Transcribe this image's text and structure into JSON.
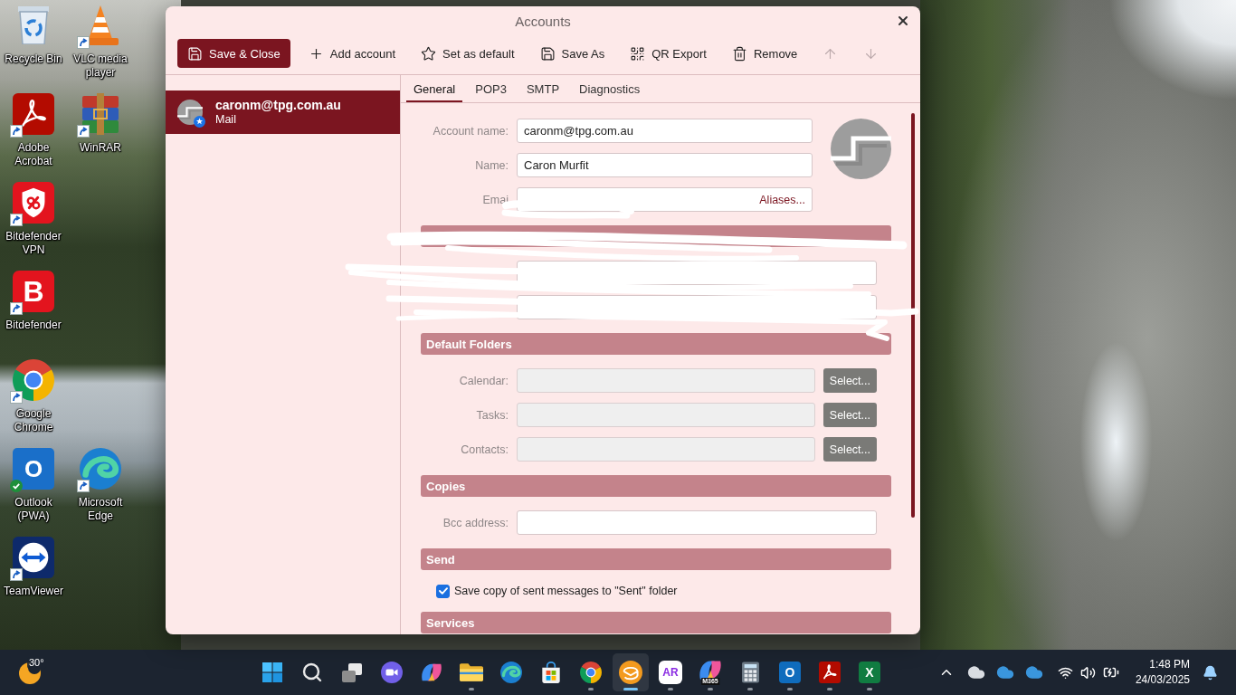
{
  "desktop_icons": [
    {
      "label": "Recycle Bin",
      "kind": "bin",
      "shortcut": false,
      "synced": false
    },
    {
      "label": "VLC media player",
      "kind": "cone",
      "shortcut": true,
      "synced": false
    },
    {
      "label": "Adobe Acrobat",
      "kind": "pdf",
      "shortcut": true,
      "synced": false
    },
    {
      "label": "WinRAR",
      "kind": "books",
      "shortcut": true,
      "synced": false
    },
    {
      "label": "Bitdefender VPN",
      "kind": "shield",
      "shortcut": true,
      "synced": false
    },
    {
      "label": "Bitdefender",
      "kind": "letter",
      "glyph": "B",
      "shortcut": true,
      "synced": false
    },
    {
      "label": "Google Chrome",
      "kind": "ring",
      "shortcut": true,
      "synced": false
    },
    {
      "label": "Outlook (PWA)",
      "kind": "mail",
      "glyph": "O",
      "shortcut": false,
      "synced": true
    },
    {
      "label": "Microsoft Edge",
      "kind": "wave",
      "shortcut": true,
      "synced": false
    },
    {
      "label": "TeamViewer",
      "kind": "arrows",
      "shortcut": true,
      "synced": false
    }
  ],
  "window": {
    "title": "Accounts"
  },
  "toolbar": [
    {
      "label": "Save & Close",
      "kind": "save",
      "primary": true,
      "disabled": false
    },
    {
      "label": "Add account",
      "kind": "add",
      "primary": false,
      "disabled": false
    },
    {
      "label": "Set as default",
      "kind": "star",
      "primary": false,
      "disabled": false
    },
    {
      "label": "Save As",
      "kind": "saveas",
      "primary": false,
      "disabled": false
    },
    {
      "label": "QR Export",
      "kind": "qr",
      "primary": false,
      "disabled": false
    },
    {
      "label": "Remove",
      "kind": "remove",
      "primary": false,
      "disabled": false
    },
    {
      "kind": "up",
      "primary": false,
      "disabled": true
    },
    {
      "kind": "down",
      "primary": false,
      "disabled": true
    }
  ],
  "accounts": [
    {
      "address": "caronm@tpg.com.au",
      "type": "Mail",
      "selected": true,
      "default": true
    }
  ],
  "tabs": [
    {
      "label": "General",
      "selected": true
    },
    {
      "label": "POP3",
      "selected": false
    },
    {
      "label": "SMTP",
      "selected": false
    },
    {
      "label": "Diagnostics",
      "selected": false
    }
  ],
  "identity": {
    "fields": [
      {
        "label": "Account name:",
        "value": "caronm@tpg.com.au",
        "redacted": false
      },
      {
        "label": "Name:",
        "value": "Caron Murfit",
        "redacted": false
      },
      {
        "label": "Emai",
        "action": "Aliases...",
        "redacted": true
      }
    ]
  },
  "sections": [
    {
      "redacted": true,
      "rows": [
        {
          "kind": "field",
          "disabled": false
        },
        {
          "kind": "field",
          "disabled": false
        }
      ]
    },
    {
      "title": "Default Folders",
      "redacted": false,
      "rows": [
        {
          "kind": "folder",
          "label": "Calendar:",
          "button": "Select...",
          "disabled": true
        },
        {
          "kind": "folder",
          "label": "Tasks:",
          "button": "Select...",
          "disabled": true
        },
        {
          "kind": "folder",
          "label": "Contacts:",
          "button": "Select...",
          "disabled": true
        }
      ]
    },
    {
      "title": "Copies",
      "redacted": false,
      "rows": [
        {
          "kind": "field",
          "label": "Bcc address:",
          "disabled": false
        }
      ]
    },
    {
      "title": "Send",
      "redacted": false,
      "rows": [
        {
          "kind": "check",
          "label": "Save copy of sent messages to \"Sent\" folder",
          "checked": true,
          "disabled": false
        }
      ]
    },
    {
      "title": "Services",
      "redacted": false
    }
  ],
  "taskbar": {
    "weather": {
      "temperature": "30°"
    },
    "apps": [
      {
        "kind": "start",
        "running": false,
        "selected": false
      },
      {
        "kind": "search",
        "running": false,
        "selected": false
      },
      {
        "kind": "taskview",
        "running": false,
        "selected": false
      },
      {
        "kind": "meet",
        "running": false,
        "selected": false
      },
      {
        "kind": "swirl",
        "running": false,
        "selected": false
      },
      {
        "kind": "folder",
        "running": true,
        "selected": false
      },
      {
        "kind": "wave",
        "running": false,
        "selected": false
      },
      {
        "kind": "store",
        "running": false,
        "selected": false
      },
      {
        "kind": "ring",
        "running": true,
        "selected": false
      },
      {
        "kind": "mailclient",
        "running": true,
        "selected": true
      },
      {
        "kind": "lettertile",
        "glyph": "AR",
        "running": true,
        "selected": false
      },
      {
        "kind": "swirlbadge",
        "glyph": "M365",
        "running": true,
        "selected": false
      },
      {
        "kind": "calculator",
        "running": true,
        "selected": false
      },
      {
        "kind": "mail",
        "glyph": "O",
        "running": true,
        "selected": false
      },
      {
        "kind": "pdf",
        "running": true,
        "selected": false
      },
      {
        "kind": "sheet",
        "glyph": "X",
        "running": true,
        "selected": false
      }
    ],
    "clock": {
      "time": "1:48 PM",
      "date": "24/03/2025"
    }
  }
}
